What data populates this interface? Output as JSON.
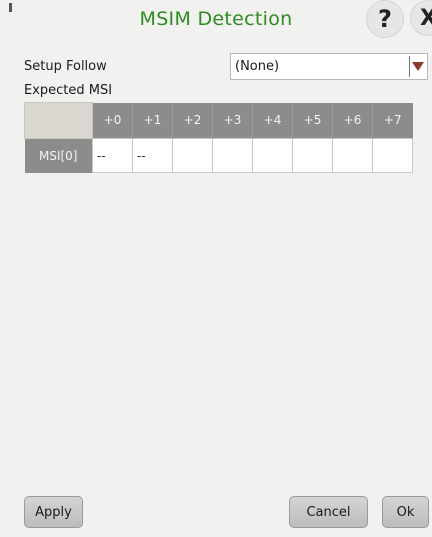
{
  "dialog": {
    "title": "MSIM Detection",
    "help_icon_glyph": "?",
    "close_icon_glyph": "X"
  },
  "setup_follow": {
    "label": "Setup Follow",
    "selected": "(None)"
  },
  "expected_msi": {
    "label": "Expected MSI",
    "column_headers": [
      "+0",
      "+1",
      "+2",
      "+3",
      "+4",
      "+5",
      "+6",
      "+7"
    ],
    "rows": [
      {
        "label": "MSI[0]",
        "cells": [
          "--",
          "--",
          "",
          "",
          "",
          "",
          "",
          ""
        ]
      }
    ]
  },
  "buttons": {
    "apply": "Apply",
    "cancel": "Cancel",
    "ok": "Ok"
  },
  "colors": {
    "title": "#2e8b22",
    "header_bg": "#8c8c8a",
    "dropdown_arrow": "#8a3a2c"
  }
}
